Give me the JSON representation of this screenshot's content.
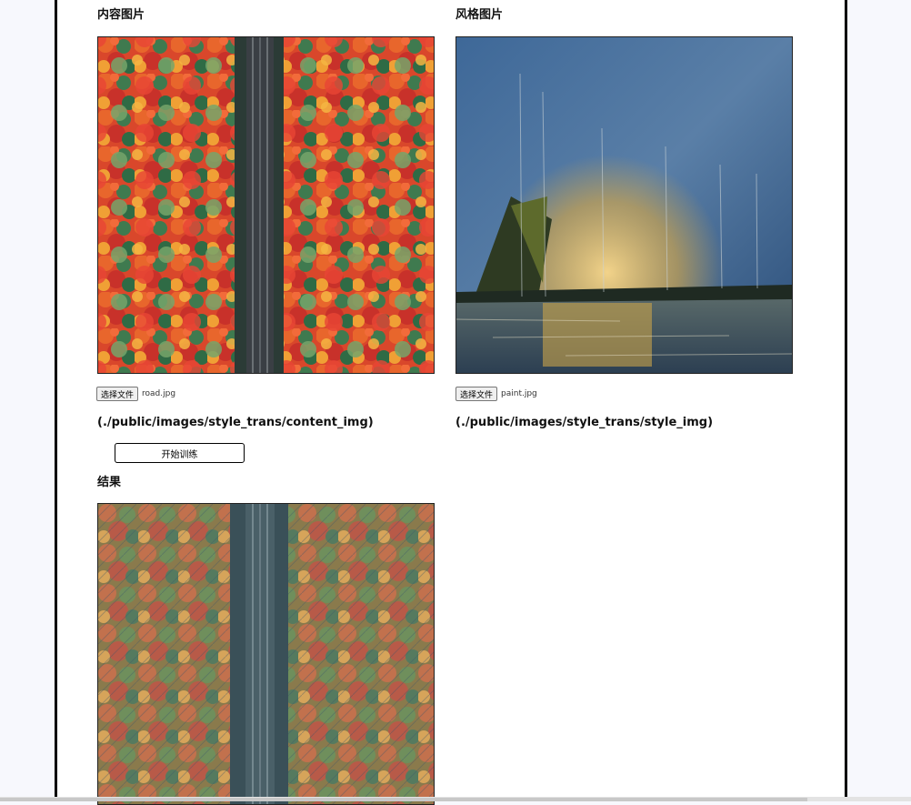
{
  "content": {
    "heading": "内容图片",
    "file_button": "选择文件",
    "file_name": "road.jpg",
    "path": "(./public/images/style_trans/content_img)"
  },
  "style": {
    "heading": "风格图片",
    "file_button": "选择文件",
    "file_name": "paint.jpg",
    "path": "(./public/images/style_trans/style_img)"
  },
  "actions": {
    "train_label": "开始训练"
  },
  "result": {
    "heading": "结果"
  }
}
